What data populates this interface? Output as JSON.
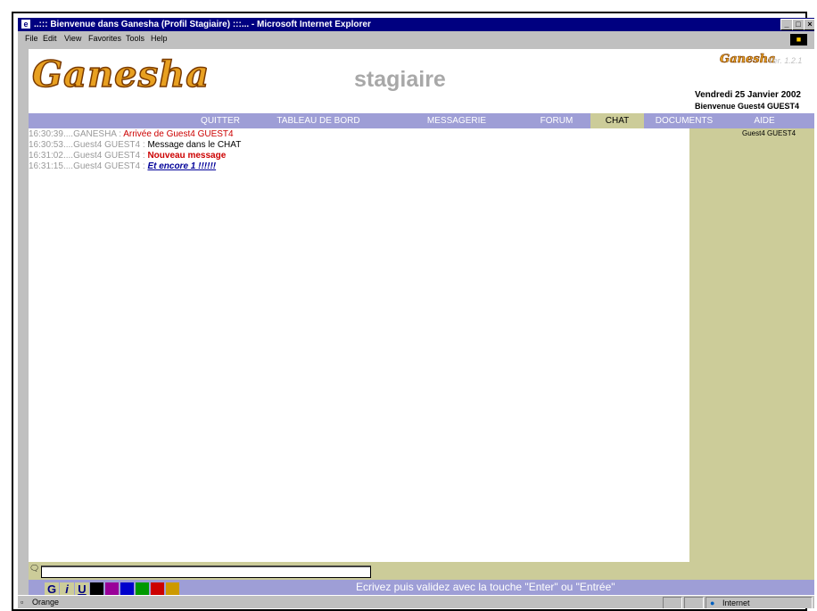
{
  "window": {
    "title": "..::: Bienvenue dans Ganesha (Profil Stagiaire) :::... - Microsoft Internet Explorer",
    "controls": [
      "_",
      "□",
      "×"
    ]
  },
  "menubar": {
    "items": [
      "File",
      "Edit",
      "View",
      "Favorites",
      "Tools",
      "Help"
    ]
  },
  "header": {
    "brand": "Ganesha",
    "profile": "stagiaire",
    "brand_small": "Ganesha",
    "version": "Ver. 1.2.1",
    "date": "Vendredi 25 Janvier 2002",
    "welcome": "Bienvenue Guest4 GUEST4"
  },
  "nav": {
    "items": [
      "QUITTER",
      "TABLEAU DE BORD",
      "MESSAGERIE",
      "FORUM",
      "CHAT",
      "DOCUMENTS",
      "AIDE"
    ],
    "active": "CHAT"
  },
  "users": {
    "online": [
      "Guest4 GUEST4"
    ]
  },
  "chat": {
    "messages": [
      {
        "time": "16:30:39",
        "author": "GANESHA",
        "text": "Arrivée de Guest4 GUEST4",
        "color": "#cc0000"
      },
      {
        "time": "16:30:53",
        "author": "Guest4 GUEST4",
        "text": "Message dans le CHAT",
        "color": "#000000"
      },
      {
        "time": "16:31:02",
        "author": "Guest4 GUEST4",
        "text": "Nouveau message",
        "color": "#cc0000"
      },
      {
        "time": "16:31:15",
        "author": "Guest4 GUEST4",
        "text": "Et encore 1 !!!!!!",
        "color": "#000099"
      }
    ],
    "input_value": ""
  },
  "toolbar": {
    "bold": "G",
    "italic": "i",
    "underline": "U",
    "colors": [
      "#000000",
      "#990099",
      "#0000cc",
      "#009900",
      "#cc0000",
      "#cc9900"
    ],
    "hint": "Ecrivez puis validez avec la touche \"Enter\" ou \"Entrée\""
  },
  "statusbar": {
    "text": "Orange",
    "zone": "Internet"
  }
}
